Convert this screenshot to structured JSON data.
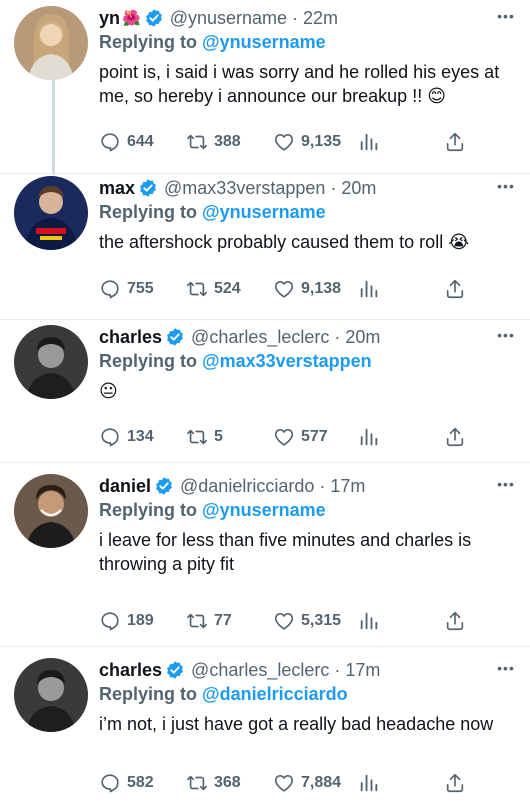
{
  "tweets": [
    {
      "name": "yn",
      "emoji": "🌺",
      "handle": "@ynusername",
      "time": "22m",
      "replying_prefix": "Replying to",
      "replying_to": "@ynusername",
      "text": "point is, i said i was sorry and he rolled his eyes at me, so hereby i announce our breakup !! 😊",
      "replies": "644",
      "retweets": "388",
      "likes": "9,135"
    },
    {
      "name": "max",
      "handle": "@max33verstappen",
      "time": "20m",
      "replying_prefix": "Replying to",
      "replying_to": "@ynusername",
      "text": "the aftershock probably caused them to roll 😭",
      "replies": "755",
      "retweets": "524",
      "likes": "9,138"
    },
    {
      "name": "charles",
      "handle": "@charles_leclerc",
      "time": "20m",
      "replying_prefix": "Replying to",
      "replying_to": "@max33verstappen",
      "text": "😐",
      "replies": "134",
      "retweets": "5",
      "likes": "577"
    },
    {
      "name": "daniel",
      "handle": "@danielricciardo",
      "time": "17m",
      "replying_prefix": "Replying to",
      "replying_to": "@ynusername",
      "text": "i leave for less than five minutes and charles is throwing a pity fit",
      "replies": "189",
      "retweets": "77",
      "likes": "5,315"
    },
    {
      "name": "charles",
      "handle": "@charles_leclerc",
      "time": "17m",
      "replying_prefix": "Replying to",
      "replying_to": "@danielricciardo",
      "text": "i’m not, i just have got a really bad headache now",
      "replies": "582",
      "retweets": "368",
      "likes": "7,884"
    }
  ],
  "icons": {
    "verified": "verified-badge-icon",
    "more": "more-icon",
    "reply": "reply-icon",
    "retweet": "retweet-icon",
    "like": "like-icon",
    "views": "views-icon",
    "share": "share-icon"
  },
  "colors": {
    "accent": "#1d9bf0",
    "secondary_text": "#536471",
    "thread_line": "#cfd9de"
  }
}
